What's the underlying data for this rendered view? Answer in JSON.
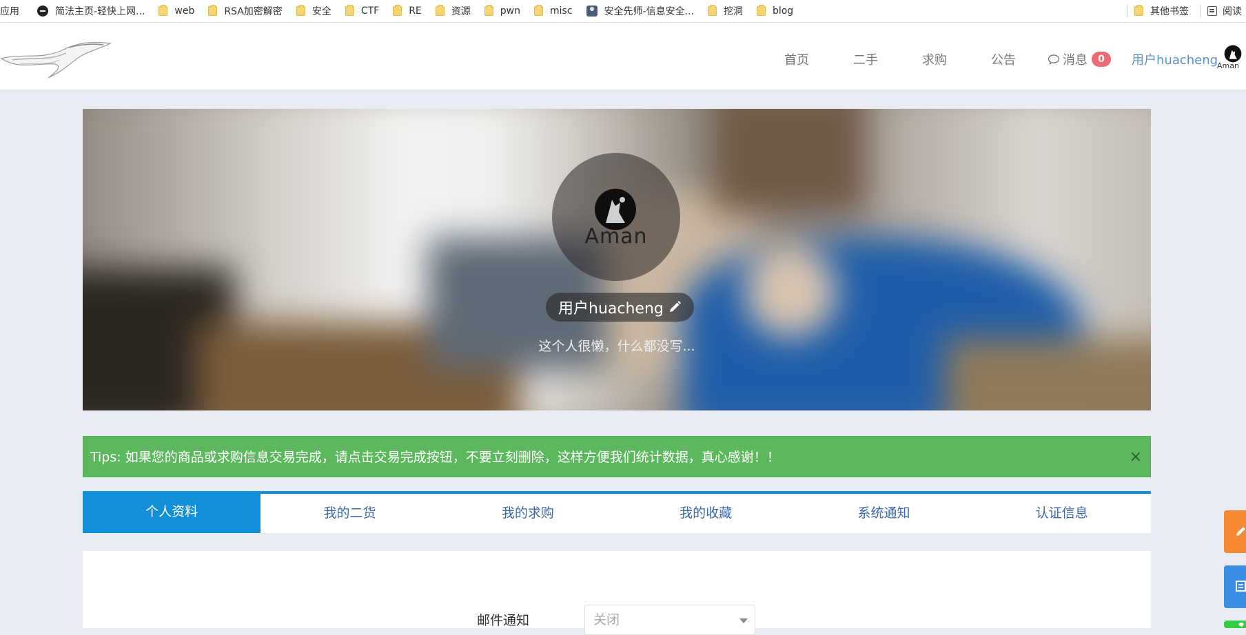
{
  "bookmarks": {
    "items": [
      {
        "label": "应用",
        "icon": "apps-icon"
      },
      {
        "label": "简法主页-轻快上网...",
        "icon": "site-round-icon"
      },
      {
        "label": "web",
        "icon": "folder-icon"
      },
      {
        "label": "RSA加密解密",
        "icon": "folder-icon"
      },
      {
        "label": "安全",
        "icon": "folder-icon"
      },
      {
        "label": "CTF",
        "icon": "folder-icon"
      },
      {
        "label": "RE",
        "icon": "folder-icon"
      },
      {
        "label": "资源",
        "icon": "folder-icon"
      },
      {
        "label": "pwn",
        "icon": "folder-icon"
      },
      {
        "label": "misc",
        "icon": "folder-icon"
      },
      {
        "label": "安全先师-信息安全...",
        "icon": "site-person-icon"
      },
      {
        "label": "挖洞",
        "icon": "folder-icon"
      },
      {
        "label": "blog",
        "icon": "folder-icon"
      }
    ],
    "other_label": "其他书签",
    "reading_label": "阅读"
  },
  "nav": {
    "home": "首页",
    "secondhand": "二手",
    "wanted": "求购",
    "notice": "公告",
    "messages": "消息",
    "message_count": "0",
    "user": "用户huacheng",
    "avatar_text": "Aman"
  },
  "profile": {
    "avatar_brand": "Aman",
    "username": "用户huacheng",
    "bio": "这个人很懒，什么都没写..."
  },
  "tips": {
    "text": "Tips: 如果您的商品或求购信息交易完成，请点击交易完成按钮，不要立刻删除，这样方便我们统计数据，真心感谢！！",
    "close": "×"
  },
  "tabs": [
    {
      "label": "个人资料",
      "active": true
    },
    {
      "label": "我的二货",
      "active": false
    },
    {
      "label": "我的求购",
      "active": false
    },
    {
      "label": "我的收藏",
      "active": false
    },
    {
      "label": "系统通知",
      "active": false
    },
    {
      "label": "认证信息",
      "active": false
    }
  ],
  "settings": {
    "email_label": "邮件通知",
    "email_value": "关闭"
  },
  "colors": {
    "accent": "#1190d9",
    "tips_bg": "#5cb85c",
    "badge": "#ec6a73",
    "float_orange": "#f68a34",
    "float_blue": "#3a8ee6",
    "float_green": "#33cc44"
  }
}
